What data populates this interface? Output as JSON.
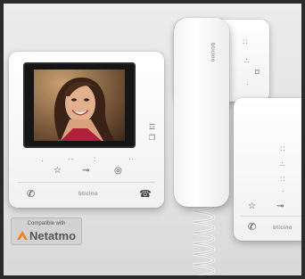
{
  "devices": {
    "main_brand": "bticino",
    "handset_brand": "bticino",
    "secondary_brand": "bticino"
  },
  "badge": {
    "line1": "Compatible with",
    "line2": "Netatmo",
    "accent_color": "#f07d1a"
  },
  "icons": {
    "phone_answer": "phone-icon",
    "phone_hangup": "hangup-icon",
    "favorite": "star-icon",
    "door_key": "key-icon",
    "view": "eye-icon",
    "wifi": "wifi-icon"
  }
}
